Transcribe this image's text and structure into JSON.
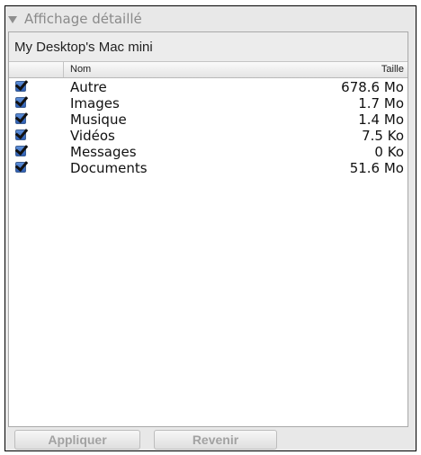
{
  "disclosure": {
    "label": "Affichage détaillé",
    "icon": "disclosure-triangle-down-icon"
  },
  "device": {
    "name": "My Desktop's Mac mini"
  },
  "table": {
    "columns": {
      "name": "Nom",
      "size": "Taille"
    },
    "rows": [
      {
        "checked": true,
        "name": "Autre",
        "size": "678.6 Mo"
      },
      {
        "checked": true,
        "name": "Images",
        "size": "1.7 Mo"
      },
      {
        "checked": true,
        "name": "Musique",
        "size": "1.4 Mo"
      },
      {
        "checked": true,
        "name": "Vidéos",
        "size": "7.5 Ko"
      },
      {
        "checked": true,
        "name": "Messages",
        "size": "0 Ko"
      },
      {
        "checked": true,
        "name": "Documents",
        "size": "51.6 Mo"
      }
    ]
  },
  "buttons": {
    "apply": "Appliquer",
    "revert": "Revenir"
  },
  "colors": {
    "checkbox": "#3f6fc4",
    "disabled_text": "#a2a2a2"
  }
}
